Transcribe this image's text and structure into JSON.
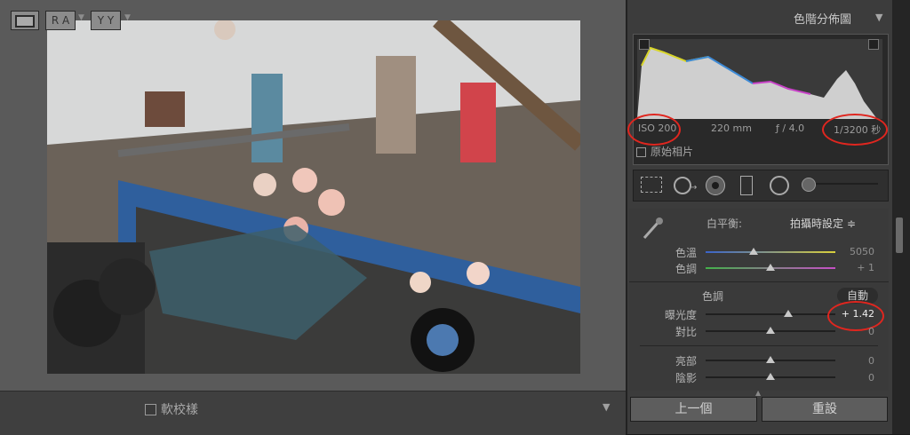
{
  "toolbar": {
    "view_mode_icon": "single-view-icon",
    "ra_label": "R A",
    "yy_label": "Y Y",
    "softproof_label": "軟校樣"
  },
  "histogram": {
    "title": "色階分佈圖",
    "iso": "ISO 200",
    "focal": "220 mm",
    "aperture": "ƒ / 4.0",
    "shutter": "1/3200 秒",
    "original_photo_label": "原始相片"
  },
  "basic": {
    "wb_label": "白平衡:",
    "wb_value": "拍攝時設定 ≑",
    "temp_label": "色溫",
    "temp_value": "5050",
    "tint_label": "色調",
    "tint_value": "+ 1",
    "tone_label": "色調",
    "auto_label": "自動",
    "exposure_label": "曝光度",
    "exposure_value": "+ 1.42",
    "contrast_label": "對比",
    "contrast_value": "0",
    "highlights_label": "亮部",
    "highlights_value": "0",
    "shadows_label": "陰影",
    "shadows_value": "0"
  },
  "buttons": {
    "previous": "上一個",
    "reset": "重設"
  },
  "levels": {
    "temp": 0.37,
    "tint": 0.5,
    "exposure": 0.64,
    "contrast": 0.5,
    "highlights": 0.5,
    "shadows": 0.5
  }
}
